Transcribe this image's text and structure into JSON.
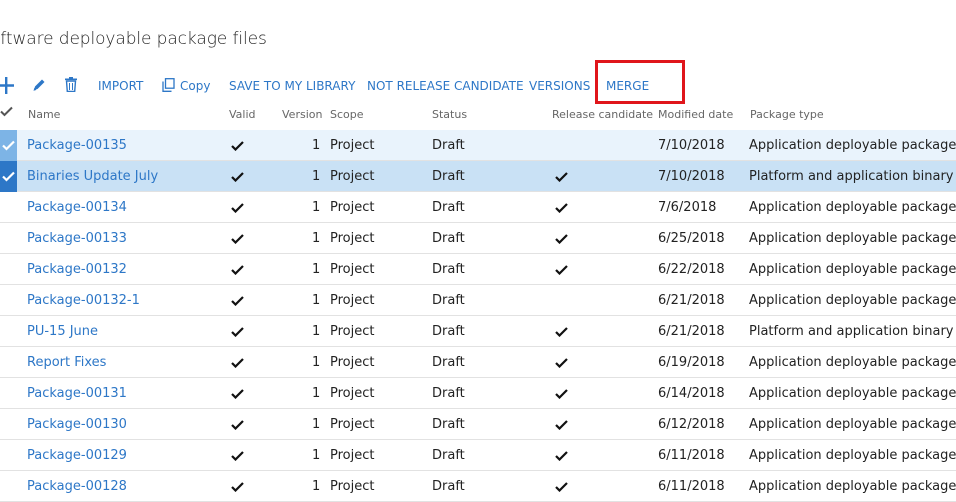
{
  "page": {
    "title": "oftware deployable package files"
  },
  "toolbar": {
    "import": "IMPORT",
    "copy": "Copy",
    "save_to_library": "SAVE TO MY LIBRARY",
    "not_release_candidate": "NOT RELEASE CANDIDATE",
    "versions": "VERSIONS",
    "merge": "MERGE"
  },
  "columns": {
    "name": "Name",
    "valid": "Valid",
    "version": "Version",
    "scope": "Scope",
    "status": "Status",
    "release_candidate": "Release candidate",
    "modified_date": "Modified date",
    "package_type": "Package type"
  },
  "rows": [
    {
      "name": "Package-00135",
      "valid": true,
      "version": "1",
      "scope": "Project",
      "status": "Draft",
      "release_candidate": false,
      "modified": "7/10/2018",
      "type": "Application deployable package",
      "selected": "light"
    },
    {
      "name": "Binaries Update July",
      "valid": true,
      "version": "1",
      "scope": "Project",
      "status": "Draft",
      "release_candidate": true,
      "modified": "7/10/2018",
      "type": "Platform and application binary pa",
      "selected": "dark"
    },
    {
      "name": "Package-00134",
      "valid": true,
      "version": "1",
      "scope": "Project",
      "status": "Draft",
      "release_candidate": true,
      "modified": "7/6/2018",
      "type": "Application deployable package",
      "selected": ""
    },
    {
      "name": "Package-00133",
      "valid": true,
      "version": "1",
      "scope": "Project",
      "status": "Draft",
      "release_candidate": true,
      "modified": "6/25/2018",
      "type": "Application deployable package",
      "selected": ""
    },
    {
      "name": "Package-00132",
      "valid": true,
      "version": "1",
      "scope": "Project",
      "status": "Draft",
      "release_candidate": true,
      "modified": "6/22/2018",
      "type": "Application deployable package",
      "selected": ""
    },
    {
      "name": "Package-00132-1",
      "valid": true,
      "version": "1",
      "scope": "Project",
      "status": "Draft",
      "release_candidate": false,
      "modified": "6/21/2018",
      "type": "Application deployable package",
      "selected": ""
    },
    {
      "name": "PU-15 June",
      "valid": true,
      "version": "1",
      "scope": "Project",
      "status": "Draft",
      "release_candidate": true,
      "modified": "6/21/2018",
      "type": "Platform and application binary pa",
      "selected": ""
    },
    {
      "name": "Report Fixes",
      "valid": true,
      "version": "1",
      "scope": "Project",
      "status": "Draft",
      "release_candidate": true,
      "modified": "6/19/2018",
      "type": "Application deployable package",
      "selected": ""
    },
    {
      "name": "Package-00131",
      "valid": true,
      "version": "1",
      "scope": "Project",
      "status": "Draft",
      "release_candidate": true,
      "modified": "6/14/2018",
      "type": "Application deployable package",
      "selected": ""
    },
    {
      "name": "Package-00130",
      "valid": true,
      "version": "1",
      "scope": "Project",
      "status": "Draft",
      "release_candidate": true,
      "modified": "6/12/2018",
      "type": "Application deployable package",
      "selected": ""
    },
    {
      "name": "Package-00129",
      "valid": true,
      "version": "1",
      "scope": "Project",
      "status": "Draft",
      "release_candidate": true,
      "modified": "6/11/2018",
      "type": "Application deployable package",
      "selected": ""
    },
    {
      "name": "Package-00128",
      "valid": true,
      "version": "1",
      "scope": "Project",
      "status": "Draft",
      "release_candidate": true,
      "modified": "6/11/2018",
      "type": "Application deployable package",
      "selected": ""
    }
  ]
}
